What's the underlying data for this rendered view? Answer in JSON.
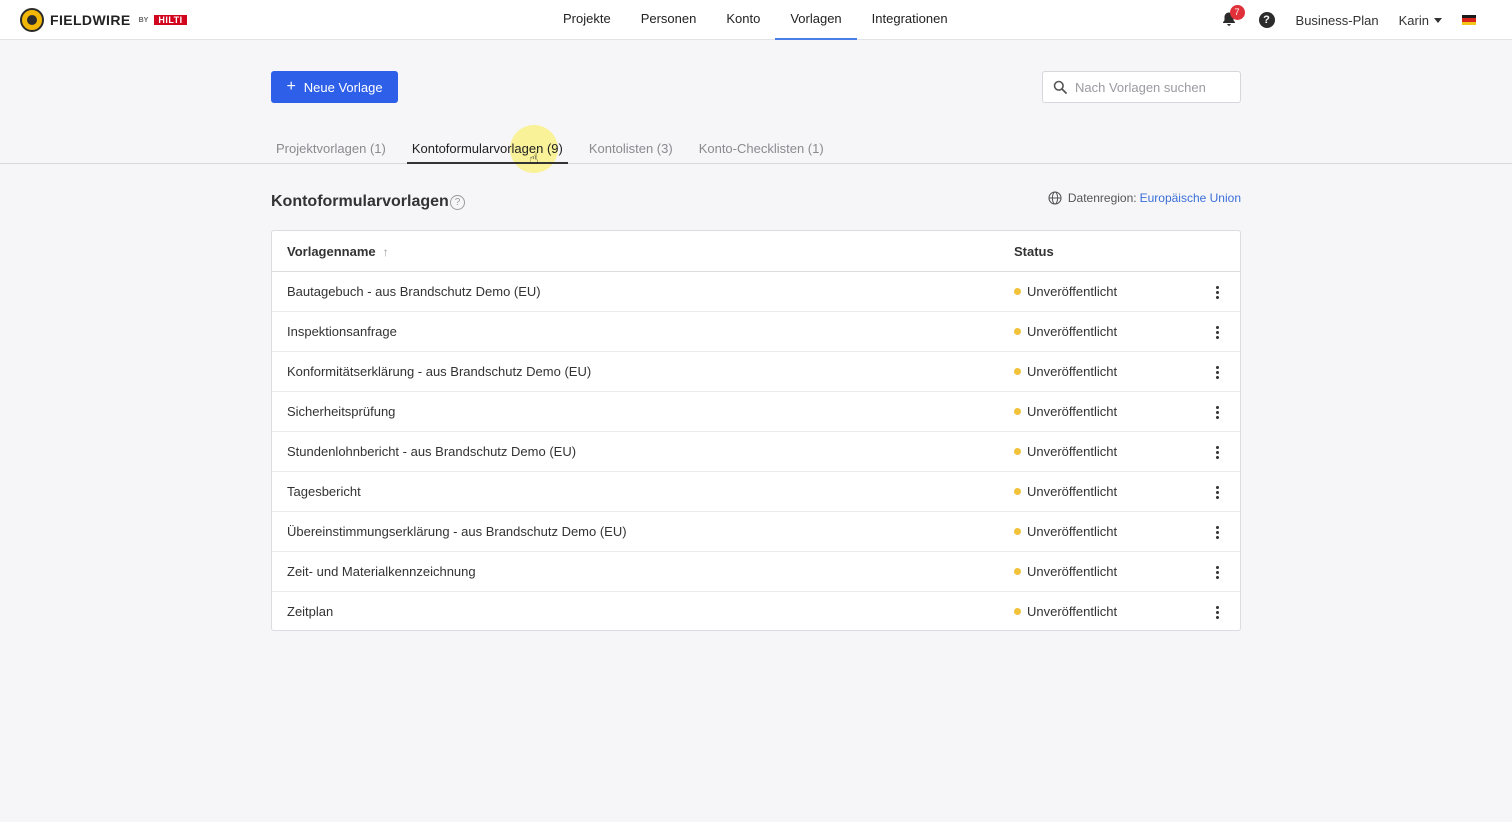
{
  "brand": {
    "name": "FIELDWIRE",
    "by": "BY",
    "partner": "HILTI"
  },
  "nav": {
    "items": [
      {
        "label": "Projekte"
      },
      {
        "label": "Personen"
      },
      {
        "label": "Konto"
      },
      {
        "label": "Vorlagen",
        "active": true
      },
      {
        "label": "Integrationen"
      }
    ]
  },
  "topbar": {
    "notification_count": "7",
    "help_icon": "?",
    "plan": "Business-Plan",
    "user": "Karin",
    "flag": "german-flag"
  },
  "toolbar": {
    "new_button_label": "Neue Vorlage",
    "search_placeholder": "Nach Vorlagen suchen"
  },
  "tabs": [
    {
      "label": "Projektvorlagen (1)"
    },
    {
      "label": "Kontoformularvorlagen (9)",
      "active": true
    },
    {
      "label": "Kontolisten (3)"
    },
    {
      "label": "Konto-Checklisten (1)"
    }
  ],
  "section": {
    "title": "Kontoformularvorlagen",
    "region_label": "Datenregion:",
    "region_value": "Europäische Union"
  },
  "table": {
    "columns": {
      "name": "Vorlagenname",
      "status": "Status"
    },
    "rows": [
      {
        "name": "Bautagebuch - aus Brandschutz Demo (EU)",
        "status": "Unveröffentlicht"
      },
      {
        "name": "Inspektionsanfrage",
        "status": "Unveröffentlicht"
      },
      {
        "name": "Konformitätserklärung - aus Brandschutz Demo (EU)",
        "status": "Unveröffentlicht"
      },
      {
        "name": "Sicherheitsprüfung",
        "status": "Unveröffentlicht"
      },
      {
        "name": "Stundenlohnbericht - aus Brandschutz Demo (EU)",
        "status": "Unveröffentlicht"
      },
      {
        "name": "Tagesbericht",
        "status": "Unveröffentlicht"
      },
      {
        "name": "Übereinstimmungserklärung - aus Brandschutz Demo (EU)",
        "status": "Unveröffentlicht"
      },
      {
        "name": "Zeit- und Materialkennzeichnung",
        "status": "Unveröffentlicht"
      },
      {
        "name": "Zeitplan",
        "status": "Unveröffentlicht"
      }
    ]
  },
  "colors": {
    "primary": "#2e5fe8",
    "status_unpublished": "#f2c23a",
    "link": "#3a6fd8"
  }
}
